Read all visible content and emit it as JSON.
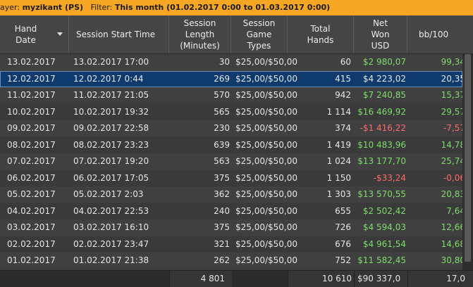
{
  "filter_bar": {
    "player_label": "ayer:",
    "player_value": "myzikant (PS)",
    "filter_label": "Filter:",
    "filter_value": "This month (01.02.2017 0:00 to 01.03.2017 0:00)"
  },
  "columns": [
    {
      "key": "date",
      "label": "Hand\nDate"
    },
    {
      "key": "start",
      "label": "Session Start Time"
    },
    {
      "key": "length",
      "label": "Session\nLength\n(Minutes)"
    },
    {
      "key": "game",
      "label": "Session\nGame\nTypes"
    },
    {
      "key": "hands",
      "label": "Total\nHands"
    },
    {
      "key": "won",
      "label": "Net\nWon\nUSD"
    },
    {
      "key": "bb",
      "label": "bb/100"
    }
  ],
  "rows": [
    {
      "date": "13.02.2017",
      "start": "13.02.2017 17:00",
      "length": "30",
      "game": "$25,00/$50,00",
      "hands": "60",
      "won": "$2 980,07",
      "bb": "99,34",
      "sign": "pos"
    },
    {
      "date": "12.02.2017",
      "start": "12.02.2017 0:44",
      "length": "269",
      "game": "$25,00/$50,00",
      "hands": "415",
      "won": "$4 223,02",
      "bb": "20,35",
      "sign": "pos",
      "selected": true
    },
    {
      "date": "11.02.2017",
      "start": "11.02.2017 21:05",
      "length": "570",
      "game": "$25,00/$50,00",
      "hands": "942",
      "won": "$7 240,85",
      "bb": "15,37",
      "sign": "pos"
    },
    {
      "date": "10.02.2017",
      "start": "10.02.2017 19:32",
      "length": "565",
      "game": "$25,00/$50,00",
      "hands": "1 114",
      "won": "$16 469,92",
      "bb": "29,57",
      "sign": "pos"
    },
    {
      "date": "09.02.2017",
      "start": "09.02.2017 22:58",
      "length": "230",
      "game": "$25,00/$50,00",
      "hands": "374",
      "won": "-$1 416,22",
      "bb": "-7,57",
      "sign": "neg"
    },
    {
      "date": "08.02.2017",
      "start": "08.02.2017 23:23",
      "length": "639",
      "game": "$25,00/$50,00",
      "hands": "1 419",
      "won": "$10 483,96",
      "bb": "14,78",
      "sign": "pos"
    },
    {
      "date": "07.02.2017",
      "start": "07.02.2017 19:20",
      "length": "563",
      "game": "$25,00/$50,00",
      "hands": "1 024",
      "won": "$13 177,70",
      "bb": "25,74",
      "sign": "pos"
    },
    {
      "date": "06.02.2017",
      "start": "06.02.2017 17:05",
      "length": "375",
      "game": "$25,00/$50,00",
      "hands": "1 150",
      "won": "-$33,24",
      "bb": "-0,06",
      "sign": "neg"
    },
    {
      "date": "05.02.2017",
      "start": "05.02.2017 2:03",
      "length": "362",
      "game": "$25,00/$50,00",
      "hands": "1 303",
      "won": "$13 570,55",
      "bb": "20,83",
      "sign": "pos"
    },
    {
      "date": "04.02.2017",
      "start": "04.02.2017 22:53",
      "length": "240",
      "game": "$25,00/$50,00",
      "hands": "655",
      "won": "$2 502,42",
      "bb": "7,64",
      "sign": "pos"
    },
    {
      "date": "03.02.2017",
      "start": "03.02.2017 16:10",
      "length": "375",
      "game": "$25,00/$50,00",
      "hands": "726",
      "won": "$4 594,03",
      "bb": "12,66",
      "sign": "pos"
    },
    {
      "date": "02.02.2017",
      "start": "02.02.2017 23:47",
      "length": "321",
      "game": "$25,00/$50,00",
      "hands": "676",
      "won": "$4 961,54",
      "bb": "14,68",
      "sign": "pos"
    },
    {
      "date": "01.02.2017",
      "start": "01.02.2017 21:38",
      "length": "262",
      "game": "$25,00/$50,00",
      "hands": "752",
      "won": "$11 582,45",
      "bb": "30,80",
      "sign": "pos"
    }
  ],
  "totals": {
    "length": "4 801",
    "hands": "10 610",
    "won": "$90 337,0",
    "bb": "17,0"
  },
  "colors": {
    "filter_bar": "#f5a623",
    "positive": "#7fdc6b",
    "negative": "#ff6a6a",
    "selected_row": "#0e3a6e"
  }
}
